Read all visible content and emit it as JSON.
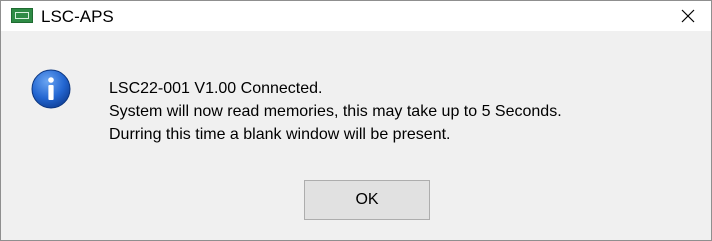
{
  "window": {
    "title": "LSC-APS",
    "app_icon": "lsc-aps-app-icon",
    "close_icon": "close-icon"
  },
  "message": {
    "icon": "info-icon",
    "icon_color": "#1a5bc4",
    "lines": [
      "LSC22-001 V1.00 Connected.",
      "System will now read memories, this may take up to 5 Seconds.",
      "Durring this time a blank window will be present."
    ]
  },
  "buttons": {
    "ok_label": "OK"
  }
}
